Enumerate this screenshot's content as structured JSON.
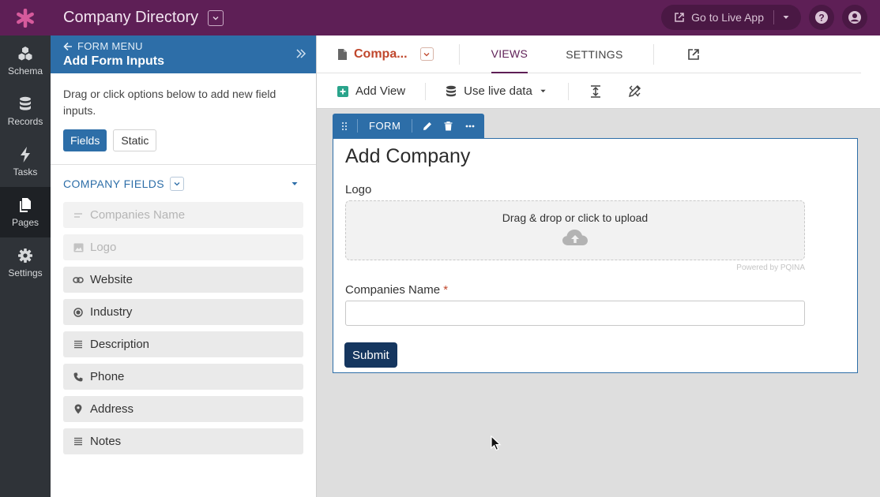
{
  "app": {
    "title": "Company Directory",
    "go_live_label": "Go to Live App",
    "icons": {
      "logo": "asterisk-logo",
      "help": "help-icon",
      "account": "user-icon"
    },
    "colors": {
      "brand": "#5e1f56",
      "nav": "#2f3338",
      "accent": "#2d6ea8",
      "page_name": "#c0472c"
    }
  },
  "nav": {
    "items": [
      {
        "label": "Schema",
        "icon": "schema-icon",
        "active": false
      },
      {
        "label": "Records",
        "icon": "database-icon",
        "active": false
      },
      {
        "label": "Tasks",
        "icon": "bolt-icon",
        "active": false
      },
      {
        "label": "Pages",
        "icon": "pages-icon",
        "active": true
      },
      {
        "label": "Settings",
        "icon": "gear-icon",
        "active": false
      }
    ]
  },
  "panel": {
    "breadcrumb": "FORM MENU",
    "title": "Add Form Inputs",
    "description": "Drag or click options below to add new field inputs.",
    "tabs": {
      "fields": "Fields",
      "static": "Static"
    },
    "section_title": "COMPANY FIELDS",
    "fields": [
      {
        "label": "Companies Name",
        "icon": "text-lines-icon",
        "disabled": true
      },
      {
        "label": "Logo",
        "icon": "image-icon",
        "disabled": true
      },
      {
        "label": "Website",
        "icon": "link-icon",
        "disabled": false
      },
      {
        "label": "Industry",
        "icon": "radio-icon",
        "disabled": false
      },
      {
        "label": "Description",
        "icon": "paragraph-icon",
        "disabled": false
      },
      {
        "label": "Phone",
        "icon": "phone-icon",
        "disabled": false
      },
      {
        "label": "Address",
        "icon": "map-pin-icon",
        "disabled": false
      },
      {
        "label": "Notes",
        "icon": "paragraph-icon",
        "disabled": false
      }
    ]
  },
  "main": {
    "page_name": "Compa...",
    "tabs": {
      "views": "VIEWS",
      "settings": "SETTINGS"
    },
    "toolbar": {
      "add_view": "Add View",
      "use_live_data": "Use live data"
    }
  },
  "form": {
    "tag_label": "FORM",
    "title": "Add Company",
    "logo_label": "Logo",
    "upload_text": "Drag & drop or click to upload",
    "powered_by": "Powered by PQINA",
    "name_label": "Companies Name",
    "required_mark": "*",
    "name_value": "",
    "submit_label": "Submit"
  }
}
